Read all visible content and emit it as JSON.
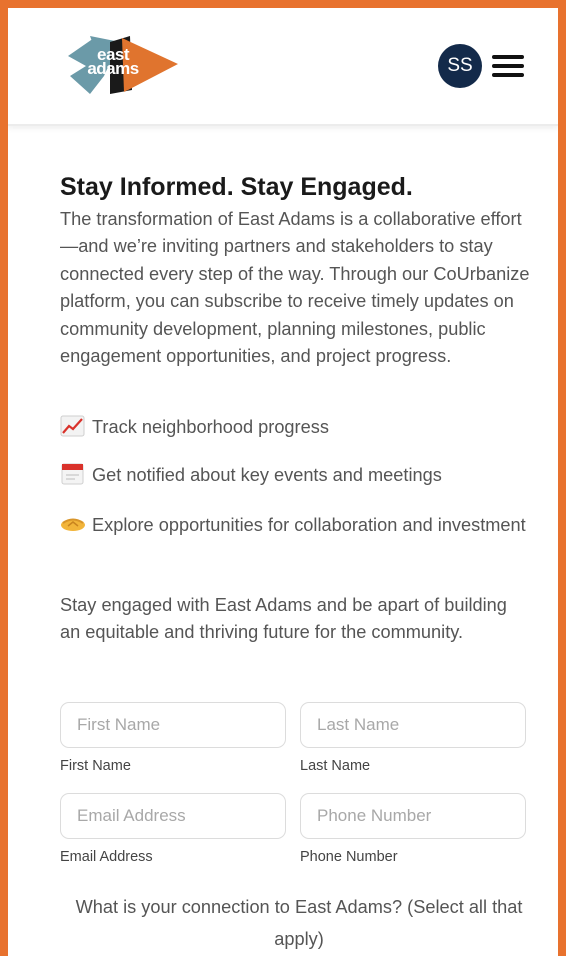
{
  "header": {
    "logo_text_line1": "east",
    "logo_text_line2": "adams",
    "avatar_initials": "SS",
    "menu_icon": "hamburger-menu-icon",
    "colors": {
      "logo_teal": "#6b9aa8",
      "logo_orange": "#e0742e",
      "logo_black": "#1a1a1a",
      "avatar_bg": "#132a4a"
    }
  },
  "main": {
    "title": "Stay Informed. Stay Engaged.",
    "intro": "The transformation of East Adams is a collaborative effort—and we’re inviting partners and stakeholders to stay connected every step of the way. Through our CoUrbanize platform, you can subscribe to receive timely updates on community development, planning milestones, public engagement opportunities, and project progress.",
    "bullets": [
      {
        "icon": "chart-increasing-icon",
        "text": "Track neighborhood progress"
      },
      {
        "icon": "calendar-icon",
        "text": "Get notified about key events and meetings"
      },
      {
        "icon": "handshake-icon",
        "text": "Explore opportunities for collaboration and investment"
      }
    ],
    "closing": "Stay engaged with East Adams and be apart of building an equitable and thriving future for the community."
  },
  "form": {
    "first_name": {
      "placeholder": "First Name",
      "label": "First Name"
    },
    "last_name": {
      "placeholder": "Last Name",
      "label": "Last Name"
    },
    "email": {
      "placeholder": "Email Address",
      "label": "Email Address"
    },
    "phone": {
      "placeholder": "Phone Number",
      "label": "Phone Number"
    },
    "connection_question": "What is your connection to East Adams? (Select all that apply)"
  }
}
